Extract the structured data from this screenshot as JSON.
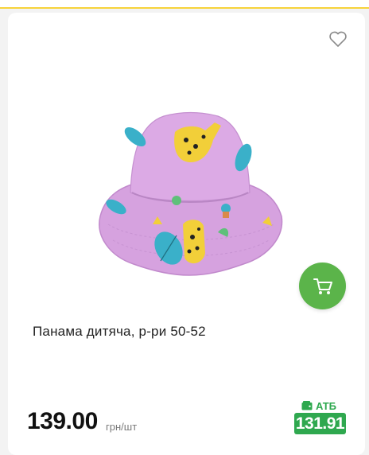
{
  "product": {
    "title": "Панама дитяча, р-ри 50-52",
    "image_description": "pink bucket hat with giraffe print",
    "price": "139.00",
    "unit": "грн/шт",
    "store_label": "АТБ",
    "store_price": "131.91"
  },
  "icons": {
    "favorite": "heart-outline-icon",
    "cart": "cart-icon",
    "store": "wallet-icon"
  },
  "colors": {
    "accent_green": "#2fa84f",
    "cart_green": "#5bb44a",
    "top_border": "#f7d33a",
    "hat_pink": "#d7a4e0"
  }
}
